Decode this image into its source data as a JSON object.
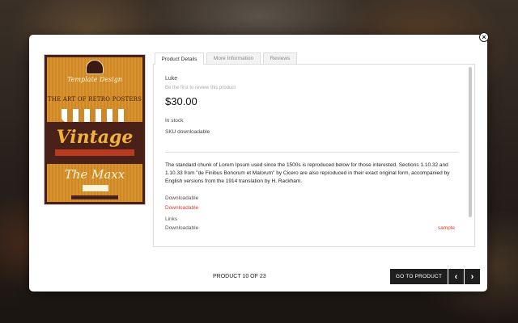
{
  "modal": {
    "close_icon": "close-icon",
    "close_glyph": "×"
  },
  "poster": {
    "subtitle": "Template Design",
    "title": "THE ART OF RETRO POSTERS",
    "main_word": "Vintage",
    "script_word": "The Maxx"
  },
  "tabs": [
    {
      "label": "Product Details",
      "active": true
    },
    {
      "label": "More Information",
      "active": false
    },
    {
      "label": "Reviews",
      "active": false
    }
  ],
  "product": {
    "vendor": "Luke",
    "review_prompt": "Be the first to review this product",
    "price": "$30.00",
    "stock": "In stock",
    "sku": "SKU downloadable",
    "description": "The standard chunk of Lorem Ipsum used since the 1500s is reproduced below for those interested. Sections 1.10.32 and 1.10.33 from \"de Finibus Bonorum et Malorum\" by Cicero are also reproduced in their exact original form, accompanied by English versions from the 1914 translation by H. Rackham.",
    "downloadable_label": "Downloadable",
    "downloadable_link": "Downloadable",
    "links_label": "Links",
    "links_item": "Downloadable",
    "sample_link": "sample"
  },
  "footer": {
    "counter": "PRODUCT 10 OF 23",
    "go_button": "GO TO PRODUCT",
    "prev_icon": "chevron-left-icon",
    "prev_glyph": "‹",
    "next_icon": "chevron-right-icon",
    "next_glyph": "›"
  },
  "colors": {
    "accent_red": "#e03a2f",
    "button_dark": "#1f1f1f"
  }
}
